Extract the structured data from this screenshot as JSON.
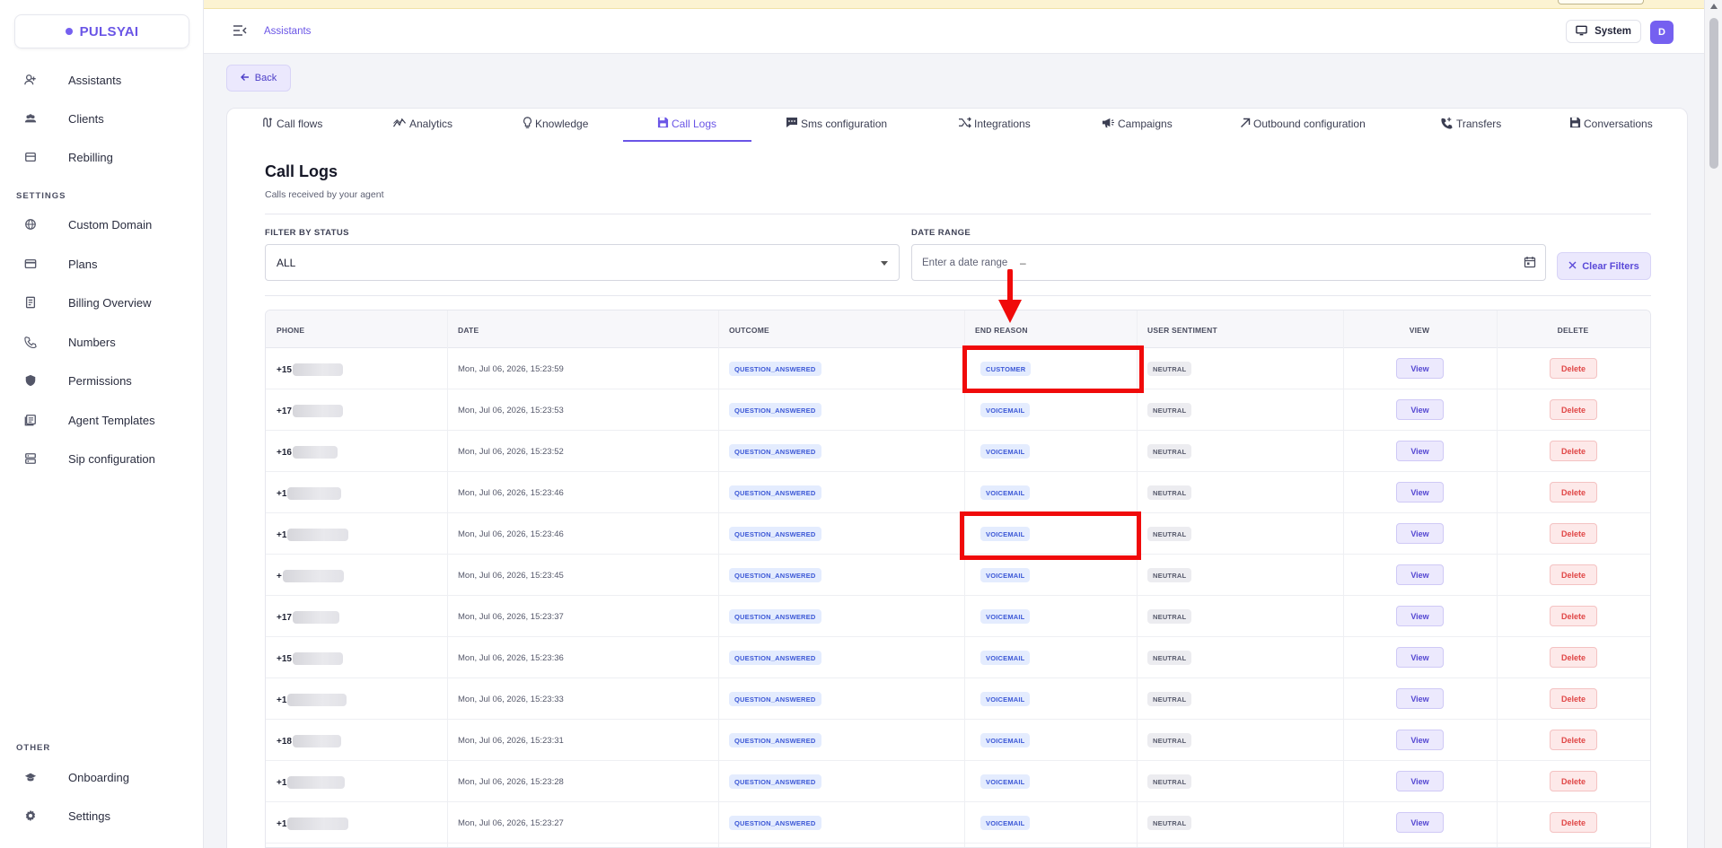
{
  "app": {
    "logo": "PULSYAI"
  },
  "sidebar": {
    "main_items": [
      {
        "label": "Assistants",
        "icon": "user-plus-icon"
      },
      {
        "label": "Clients",
        "icon": "users-icon"
      },
      {
        "label": "Rebilling",
        "icon": "receipt-icon"
      }
    ],
    "settings_heading": "SETTINGS",
    "settings_items": [
      {
        "label": "Custom Domain",
        "icon": "globe-icon"
      },
      {
        "label": "Plans",
        "icon": "credit-card-icon"
      },
      {
        "label": "Billing Overview",
        "icon": "invoice-icon"
      },
      {
        "label": "Numbers",
        "icon": "phone-icon"
      },
      {
        "label": "Permissions",
        "icon": "shield-icon"
      },
      {
        "label": "Agent Templates",
        "icon": "template-icon"
      },
      {
        "label": "Sip configuration",
        "icon": "server-icon"
      }
    ],
    "other_heading": "OTHER",
    "other_items": [
      {
        "label": "Onboarding",
        "icon": "graduation-cap-icon"
      },
      {
        "label": "Settings",
        "icon": "gear-icon"
      }
    ]
  },
  "topbar": {
    "breadcrumb": "Assistants",
    "system_label": "System",
    "avatar_initial": "D"
  },
  "back_label": "Back",
  "tabs": [
    {
      "label": "Call flows",
      "icon": "flow-icon"
    },
    {
      "label": "Analytics",
      "icon": "analytics-icon"
    },
    {
      "label": "Knowledge",
      "icon": "bulb-icon"
    },
    {
      "label": "Call Logs",
      "icon": "save-icon",
      "active": true
    },
    {
      "label": "Sms configuration",
      "icon": "sms-icon"
    },
    {
      "label": "Integrations",
      "icon": "integrations-icon"
    },
    {
      "label": "Campaigns",
      "icon": "megaphone-icon"
    },
    {
      "label": "Outbound configuration",
      "icon": "outbound-arrow-icon"
    },
    {
      "label": "Transfers",
      "icon": "phone-transfer-icon"
    },
    {
      "label": "Conversations",
      "icon": "save-icon"
    }
  ],
  "page": {
    "title": "Call Logs",
    "subtitle": "Calls received by your agent"
  },
  "filters": {
    "status_label": "FILTER BY STATUS",
    "status_value": "ALL",
    "date_label": "DATE RANGE",
    "date_placeholder": "Enter a date range",
    "date_separator": "–",
    "clear_label": "Clear Filters"
  },
  "table": {
    "columns": [
      "PHONE",
      "DATE",
      "OUTCOME",
      "END REASON",
      "USER SENTIMENT",
      "VIEW",
      "DELETE"
    ],
    "view_label": "View",
    "delete_label": "Delete",
    "rows": [
      {
        "phone": "+15",
        "date": "Mon, Jul 06, 2026, 15:23:59",
        "outcome": "QUESTION_ANSWERED",
        "end_reason": "CUSTOMER",
        "sentiment": "NEUTRAL"
      },
      {
        "phone": "+17",
        "date": "Mon, Jul 06, 2026, 15:23:53",
        "outcome": "QUESTION_ANSWERED",
        "end_reason": "VOICEMAIL",
        "sentiment": "NEUTRAL"
      },
      {
        "phone": "+16",
        "date": "Mon, Jul 06, 2026, 15:23:52",
        "outcome": "QUESTION_ANSWERED",
        "end_reason": "VOICEMAIL",
        "sentiment": "NEUTRAL"
      },
      {
        "phone": "+1",
        "date": "Mon, Jul 06, 2026, 15:23:46",
        "outcome": "QUESTION_ANSWERED",
        "end_reason": "VOICEMAIL",
        "sentiment": "NEUTRAL"
      },
      {
        "phone": "+1",
        "date": "Mon, Jul 06, 2026, 15:23:46",
        "outcome": "QUESTION_ANSWERED",
        "end_reason": "VOICEMAIL",
        "sentiment": "NEUTRAL"
      },
      {
        "phone": "+",
        "date": "Mon, Jul 06, 2026, 15:23:45",
        "outcome": "QUESTION_ANSWERED",
        "end_reason": "VOICEMAIL",
        "sentiment": "NEUTRAL"
      },
      {
        "phone": "+17",
        "date": "Mon, Jul 06, 2026, 15:23:37",
        "outcome": "QUESTION_ANSWERED",
        "end_reason": "VOICEMAIL",
        "sentiment": "NEUTRAL"
      },
      {
        "phone": "+15",
        "date": "Mon, Jul 06, 2026, 15:23:36",
        "outcome": "QUESTION_ANSWERED",
        "end_reason": "VOICEMAIL",
        "sentiment": "NEUTRAL"
      },
      {
        "phone": "+1",
        "date": "Mon, Jul 06, 2026, 15:23:33",
        "outcome": "QUESTION_ANSWERED",
        "end_reason": "VOICEMAIL",
        "sentiment": "NEUTRAL"
      },
      {
        "phone": "+18",
        "date": "Mon, Jul 06, 2026, 15:23:31",
        "outcome": "QUESTION_ANSWERED",
        "end_reason": "VOICEMAIL",
        "sentiment": "NEUTRAL"
      },
      {
        "phone": "+1",
        "date": "Mon, Jul 06, 2026, 15:23:28",
        "outcome": "QUESTION_ANSWERED",
        "end_reason": "VOICEMAIL",
        "sentiment": "NEUTRAL"
      },
      {
        "phone": "+1",
        "date": "Mon, Jul 06, 2026, 15:23:27",
        "outcome": "QUESTION_ANSWERED",
        "end_reason": "VOICEMAIL",
        "sentiment": "NEUTRAL"
      }
    ]
  },
  "colors": {
    "accent": "#6a55e6",
    "annotation": "#f00a0a",
    "delete": "#e04646"
  }
}
